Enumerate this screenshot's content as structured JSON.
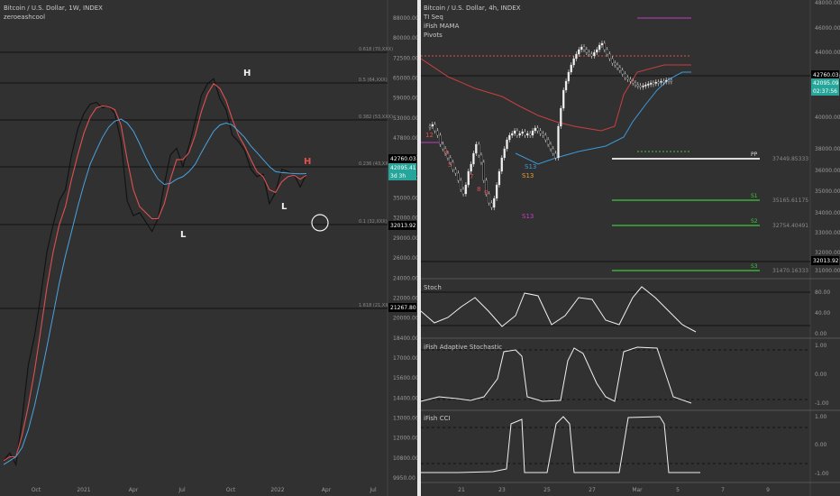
{
  "left": {
    "symbol_line": "Bitcoin / U.S. Dollar, 1W, INDEX",
    "author": "zeroeashcool",
    "y_ticks": [
      "88000.00",
      "80000.00",
      "72500.00",
      "65000.00",
      "59000.00",
      "53000.00",
      "47800.00",
      "43000.00",
      "39000.00",
      "35000.00",
      "32000.00",
      "29000.00",
      "26000.00",
      "24000.00",
      "22000.00",
      "20000.00",
      "18400.00",
      "17000.00",
      "15600.00",
      "14400.00",
      "13000.00",
      "12000.00",
      "10800.00",
      "9950.00"
    ],
    "x_ticks": [
      "Oct",
      "2021",
      "Apr",
      "Jul",
      "Oct",
      "2022",
      "Apr",
      "Jul"
    ],
    "fib_labels": [
      "0.618 (70,XXX)",
      "0.5 (64,XXX)",
      "0.382 (53,XXX)",
      "0.236 (43,XXX)",
      "0.1 (32,XXX)",
      "1.618 (21,XXX)"
    ],
    "price_tags": [
      {
        "text": "42760.03",
        "color": "#000000"
      },
      {
        "text": "42095.41",
        "color": "#26a69a"
      },
      {
        "text": "3d 3h",
        "color": "#26a69a"
      },
      {
        "text": "32013.92",
        "color": "#000000"
      },
      {
        "text": "21267.80",
        "color": "#000000"
      }
    ],
    "annotations": {
      "h1": "H",
      "h2": "H",
      "l1": "L",
      "l2": "L"
    },
    "chart_data": {
      "type": "line",
      "series": [
        {
          "values": [
            10800,
            11200,
            10600,
            13200,
            17000,
            19500,
            23500,
            29000,
            33000,
            37000,
            39000,
            46000,
            52000,
            56000,
            58500,
            59000,
            57500,
            58000,
            56000,
            49000,
            37000,
            34500,
            35000,
            33500,
            32000,
            34000,
            40000,
            46000,
            47500,
            43500,
            48000,
            54000,
            61000,
            64500,
            66000,
            60000,
            57000,
            50500,
            49000,
            47000,
            43000,
            41500,
            42000,
            36500,
            38500,
            43000,
            42500,
            42000,
            39500,
            42095
          ]
        },
        {
          "values": [
            10800,
            11000,
            11000,
            12200,
            14000,
            16500,
            20000,
            24500,
            29000,
            33000,
            36000,
            41000,
            46000,
            51000,
            55000,
            57500,
            58000,
            57800,
            57000,
            53000,
            45000,
            39000,
            36000,
            35000,
            34000,
            34000,
            36500,
            41000,
            45000,
            45000,
            46500,
            50500,
            56500,
            61500,
            64500,
            63000,
            59500,
            54500,
            50500,
            48000,
            45000,
            42500,
            41500,
            39000,
            38500,
            40500,
            41500,
            41800,
            41000,
            41800
          ]
        },
        {
          "values": [
            10600,
            10800,
            11000,
            11500,
            12500,
            14000,
            16000,
            18500,
            21500,
            25000,
            28500,
            32000,
            36000,
            40000,
            44000,
            47000,
            50000,
            52500,
            54000,
            54500,
            53500,
            51500,
            48500,
            45500,
            43000,
            41000,
            40000,
            40200,
            41000,
            41500,
            42500,
            44000,
            46500,
            49000,
            51500,
            53000,
            53500,
            53000,
            51500,
            50000,
            48000,
            46500,
            45000,
            43500,
            42500,
            42300,
            42200,
            42100,
            42050,
            42095
          ]
        }
      ]
    }
  },
  "right": {
    "symbol_line": "Bitcoin / U.S. Dollar, 4h, INDEX",
    "indicators": [
      "TI Seq",
      "iFish MAMA",
      "Pivots"
    ],
    "y_ticks": [
      "48000.00",
      "46000.00",
      "44000.00",
      "42000.00",
      "40000.00",
      "38000.00",
      "36000.00",
      "35000.00",
      "34000.00",
      "33000.00",
      "32000.00",
      "31000.00"
    ],
    "x_ticks": [
      "21",
      "23",
      "25",
      "27",
      "Mar",
      "5",
      "7",
      "9"
    ],
    "pivot_labels": [
      {
        "name": "PP",
        "value": "37449.85333"
      },
      {
        "name": "S1",
        "value": "35165.61175"
      },
      {
        "name": "S2",
        "value": "32754.40491"
      },
      {
        "name": "S3",
        "value": "31470.16333"
      }
    ],
    "price_tags": [
      {
        "text": "42760.03",
        "color": "#000000"
      },
      {
        "text": "42095.09",
        "color": "#26a69a"
      },
      {
        "text": "02:37:56",
        "color": "#26a69a"
      },
      {
        "text": "32013.92",
        "color": "#000000"
      }
    ],
    "seq_labels": [
      "12",
      "9",
      "5",
      "7",
      "8",
      "9",
      "S13",
      "S13",
      "S13"
    ],
    "stoch": {
      "title": "Stoch",
      "ticks": [
        "80.00",
        "40.00",
        "0.00"
      ]
    },
    "ifish_stoch": {
      "title": "iFish Adaptive Stochastic",
      "ticks": [
        "1.00",
        "0.00",
        "-1.00"
      ]
    },
    "ifish_cci": {
      "title": "iFish CCI",
      "ticks": [
        "1.00",
        "0.00",
        "-1.00"
      ]
    }
  }
}
